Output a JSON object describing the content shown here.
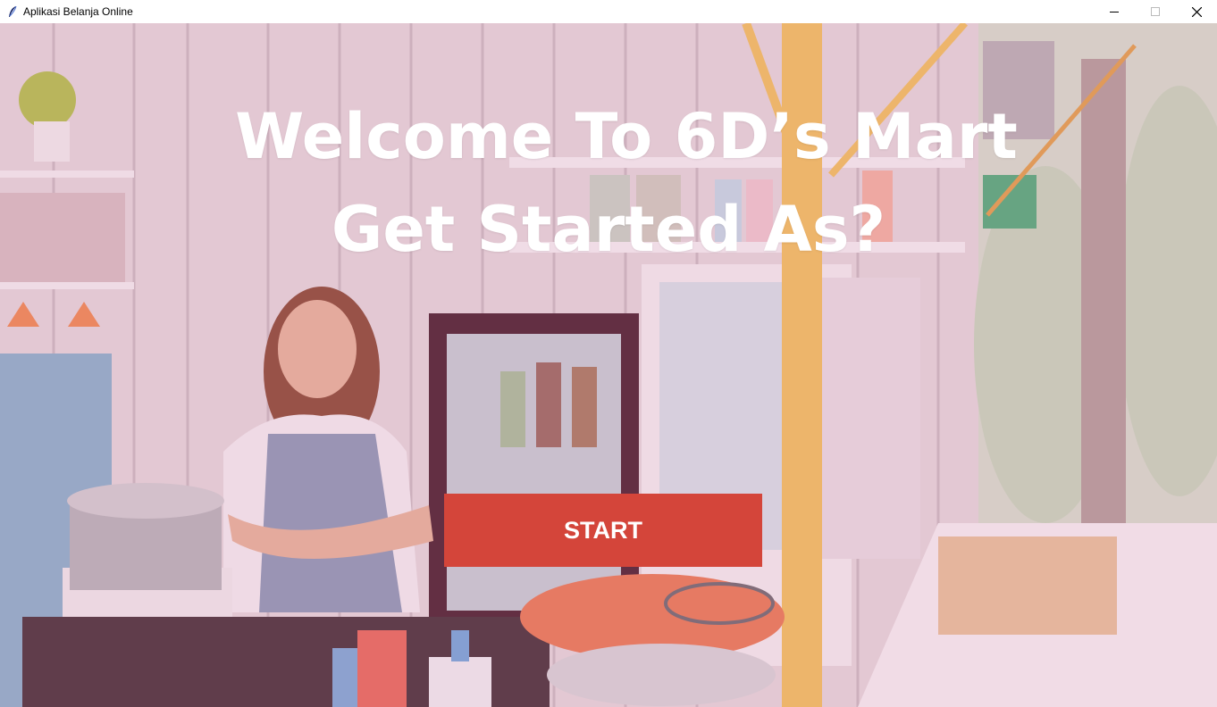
{
  "window": {
    "title": "Aplikasi Belanja Online",
    "controls": [
      "minimize",
      "maximize",
      "close"
    ]
  },
  "hero": {
    "line1": "Welcome To 6D’s Mart",
    "line2": "Get Started As?",
    "start_label": "START"
  },
  "colors": {
    "start_button": "#d4453a",
    "headline_text": "#ffffff"
  }
}
